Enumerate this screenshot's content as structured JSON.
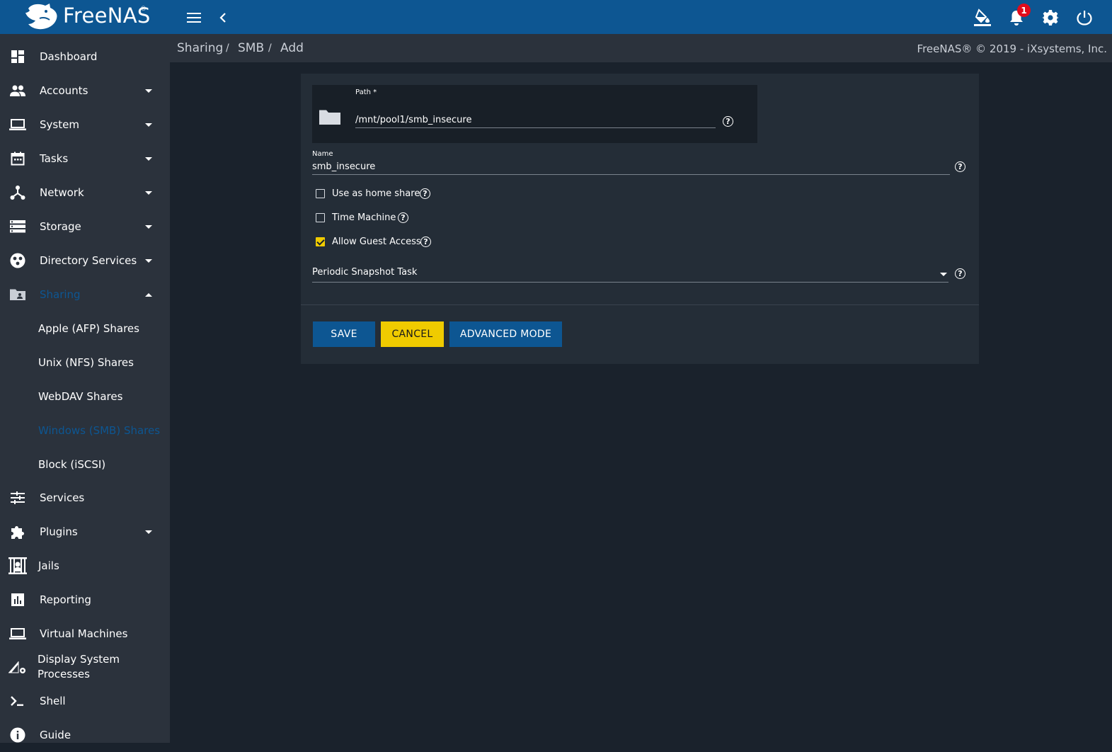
{
  "brand": {
    "name": "FreeNAS",
    "trademark": "®"
  },
  "topbar": {
    "notification_count": "1",
    "colors": {
      "bar": "#0d5692",
      "badge": "#e00b1c"
    },
    "icons": [
      "menu-icon",
      "chevron-left-icon",
      "paint-bucket-icon",
      "bell-icon",
      "gear-icon",
      "power-icon"
    ]
  },
  "sidebar": {
    "items": [
      {
        "label": "Dashboard",
        "icon": "dashboard-icon",
        "expandable": false
      },
      {
        "label": "Accounts",
        "icon": "people-icon",
        "expandable": true
      },
      {
        "label": "System",
        "icon": "laptop-icon",
        "expandable": true
      },
      {
        "label": "Tasks",
        "icon": "calendar-icon",
        "expandable": true
      },
      {
        "label": "Network",
        "icon": "network-icon",
        "expandable": true
      },
      {
        "label": "Storage",
        "icon": "storage-icon",
        "expandable": true
      },
      {
        "label": "Directory Services",
        "icon": "directory-icon",
        "expandable": true
      },
      {
        "label": "Sharing",
        "icon": "folder-shared-icon",
        "expandable": true,
        "expanded": true,
        "active": true
      }
    ],
    "sharing_sub": [
      {
        "label": "Apple (AFP) Shares"
      },
      {
        "label": "Unix (NFS) Shares"
      },
      {
        "label": "WebDAV Shares"
      },
      {
        "label": "Windows (SMB) Shares",
        "active": true
      },
      {
        "label": "Block (iSCSI)"
      }
    ],
    "items_after": [
      {
        "label": "Services",
        "icon": "tune-icon",
        "expandable": false
      },
      {
        "label": "Plugins",
        "icon": "puzzle-icon",
        "expandable": true
      },
      {
        "label": "Jails",
        "icon": "jail-icon",
        "expandable": false
      },
      {
        "label": "Reporting",
        "icon": "chart-icon",
        "expandable": false
      },
      {
        "label": "Virtual Machines",
        "icon": "laptop-icon",
        "expandable": false
      },
      {
        "label_line1": "Display System",
        "label_line2": "Processes",
        "icon": "processes-icon",
        "expandable": false
      },
      {
        "label": "Shell",
        "icon": "shell-icon",
        "expandable": false
      },
      {
        "label": "Guide",
        "icon": "info-icon",
        "expandable": false
      }
    ],
    "active_color": "#0d5692"
  },
  "breadcrumb": [
    "Sharing",
    "SMB",
    "Add"
  ],
  "breadcrumb_separator": "/",
  "copyright": "FreeNAS® © 2019 - iXsystems, Inc.",
  "form": {
    "path": {
      "label": "Path *",
      "value": "/mnt/pool1/smb_insecure"
    },
    "name": {
      "label": "Name",
      "value": "smb_insecure"
    },
    "checkboxes": [
      {
        "label": "Use as home share",
        "checked": false
      },
      {
        "label": "Time Machine",
        "checked": false
      },
      {
        "label": "Allow Guest Access",
        "checked": true
      }
    ],
    "snapshot": {
      "placeholder": "Periodic Snapshot Task"
    },
    "buttons": {
      "save": "SAVE",
      "cancel": "CANCEL",
      "advanced": "ADVANCED MODE"
    },
    "help_glyph": "?",
    "colors": {
      "primary": "#0d5692",
      "accent": "#f0cb00"
    }
  }
}
